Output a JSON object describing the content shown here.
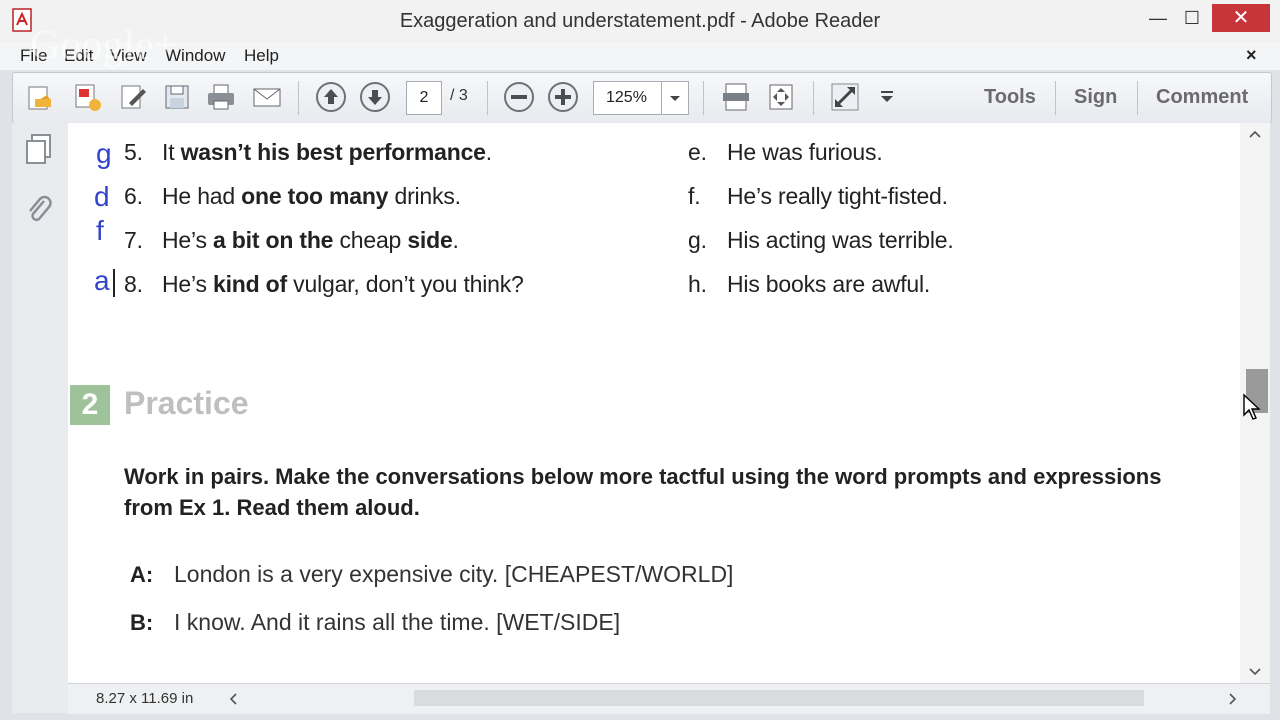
{
  "window": {
    "title": "Exaggeration and understatement.pdf - Adobe Reader",
    "minimize": "—",
    "maximize": "☐",
    "close": "✕"
  },
  "watermark": "Google+",
  "menu": [
    "File",
    "Edit",
    "View",
    "Window",
    "Help"
  ],
  "menu_close": "×",
  "toolbar": {
    "page_current": "2",
    "page_total": "/ 3",
    "zoom": "125%",
    "tools": "Tools",
    "sign": "Sign",
    "comment": "Comment"
  },
  "document": {
    "left_items": [
      {
        "mark": "g",
        "num": "5.",
        "parts": [
          [
            "It ",
            false
          ],
          [
            "wasn’t his best performance",
            true
          ],
          [
            ".",
            false
          ]
        ]
      },
      {
        "mark": "d",
        "num": "6.",
        "parts": [
          [
            "He had ",
            false
          ],
          [
            "one too many",
            true
          ],
          [
            " drinks.",
            false
          ]
        ]
      },
      {
        "mark": "f",
        "num": "7.",
        "parts": [
          [
            "He’s ",
            false
          ],
          [
            "a bit on the",
            true
          ],
          [
            " cheap ",
            false
          ],
          [
            "side",
            true
          ],
          [
            ".",
            false
          ]
        ]
      },
      {
        "mark": "a",
        "num": "8.",
        "parts": [
          [
            "He’s ",
            false
          ],
          [
            "kind of",
            true
          ],
          [
            " vulgar, don’t you think?",
            false
          ]
        ]
      }
    ],
    "right_items": [
      {
        "letter": "e.",
        "text": "He was furious."
      },
      {
        "letter": "f.",
        "text": "He’s really tight-fisted."
      },
      {
        "letter": "g.",
        "text": "His acting was terrible."
      },
      {
        "letter": "h.",
        "text": "His books are awful."
      }
    ],
    "section": {
      "number": "2",
      "title": "Practice"
    },
    "instruction": {
      "line1": "Work in pairs. Make the conversations below more tactful using the word prompts and expressions",
      "line2": "from Ex 1. Read them aloud."
    },
    "conversation": [
      {
        "speaker": "A:",
        "text": "London is a very expensive city. [CHEAPEST/WORLD]"
      },
      {
        "speaker": "B:",
        "text": "I know. And it rains all the time. [WET/SIDE]"
      }
    ]
  },
  "status": {
    "page_size": "8.27 x 11.69 in"
  },
  "colors": {
    "handwriting": "#3344cc",
    "close_button": "#c7343a",
    "section_badge": "#9ec29a"
  }
}
